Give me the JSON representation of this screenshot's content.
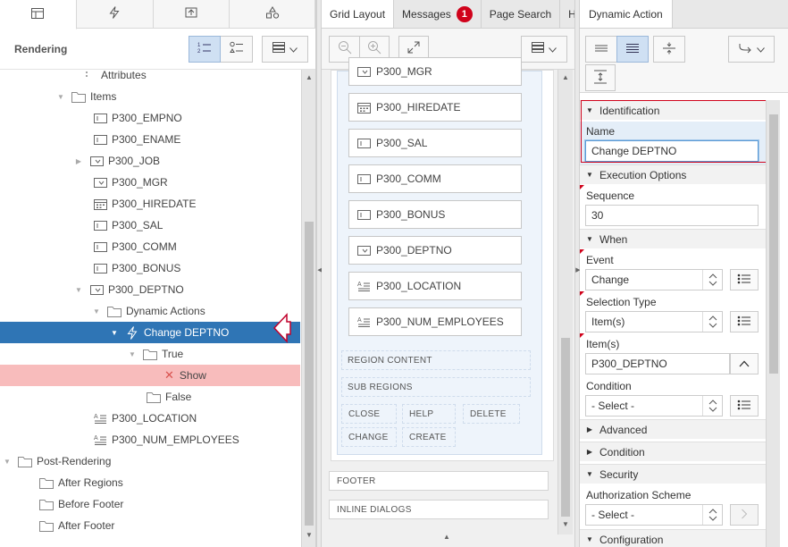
{
  "left": {
    "header_title": "Rendering",
    "tabs": [
      "rendering-tab-icon",
      "dynamic-actions-tab-icon",
      "processing-tab-icon",
      "shared-components-tab-icon"
    ],
    "tree": [
      {
        "label": "Attributes",
        "indent": 92,
        "icon": "attributes-icon",
        "toggle": ""
      },
      {
        "label": "Items",
        "indent": 80,
        "icon": "folder-icon",
        "toggle": "▼"
      },
      {
        "label": "P300_EMPNO",
        "indent": 104,
        "icon": "text-field-icon",
        "toggle": ""
      },
      {
        "label": "P300_ENAME",
        "indent": 104,
        "icon": "text-field-icon",
        "toggle": ""
      },
      {
        "label": "P300_JOB",
        "indent": 100,
        "icon": "select-list-icon",
        "toggle": "▶"
      },
      {
        "label": "P300_MGR",
        "indent": 104,
        "icon": "select-list-icon",
        "toggle": ""
      },
      {
        "label": "P300_HIREDATE",
        "indent": 104,
        "icon": "date-picker-icon",
        "toggle": ""
      },
      {
        "label": "P300_SAL",
        "indent": 104,
        "icon": "text-field-icon",
        "toggle": ""
      },
      {
        "label": "P300_COMM",
        "indent": 104,
        "icon": "text-field-icon",
        "toggle": ""
      },
      {
        "label": "P300_BONUS",
        "indent": 104,
        "icon": "text-field-icon",
        "toggle": ""
      },
      {
        "label": "P300_DEPTNO",
        "indent": 100,
        "icon": "select-list-icon",
        "toggle": "▼"
      },
      {
        "label": "Dynamic Actions",
        "indent": 120,
        "icon": "folder-icon",
        "toggle": "▼"
      },
      {
        "label": "Change DEPTNO",
        "indent": 140,
        "icon": "lightning-icon",
        "toggle": "▼",
        "selected": true
      },
      {
        "label": "True",
        "indent": 160,
        "icon": "folder-icon",
        "toggle": "▼"
      },
      {
        "label": "Show",
        "indent": 184,
        "icon": "error-icon",
        "toggle": "",
        "error": true
      },
      {
        "label": "False",
        "indent": 164,
        "icon": "folder-icon",
        "toggle": ""
      },
      {
        "label": "P300_LOCATION",
        "indent": 104,
        "icon": "textarea-icon",
        "toggle": ""
      },
      {
        "label": "P300_NUM_EMPLOYEES",
        "indent": 104,
        "icon": "textarea-icon",
        "toggle": ""
      },
      {
        "label": "Post-Rendering",
        "indent": 20,
        "icon": "folder-icon",
        "toggle": "▼"
      },
      {
        "label": "After Regions",
        "indent": 44,
        "icon": "folder-icon",
        "toggle": ""
      },
      {
        "label": "Before Footer",
        "indent": 44,
        "icon": "folder-icon",
        "toggle": ""
      },
      {
        "label": "After Footer",
        "indent": 44,
        "icon": "folder-icon",
        "toggle": ""
      }
    ]
  },
  "middle": {
    "tabs": [
      {
        "label": "Grid Layout",
        "active": true
      },
      {
        "label": "Messages",
        "badge": "1"
      },
      {
        "label": "Page Search"
      },
      {
        "label": "H"
      }
    ],
    "items": [
      {
        "label": "P300_MGR",
        "icon": "select-list-icon"
      },
      {
        "label": "P300_HIREDATE",
        "icon": "date-picker-icon"
      },
      {
        "label": "P300_SAL",
        "icon": "text-field-icon"
      },
      {
        "label": "P300_COMM",
        "icon": "text-field-icon"
      },
      {
        "label": "P300_BONUS",
        "icon": "text-field-icon"
      },
      {
        "label": "P300_DEPTNO",
        "icon": "select-list-icon"
      },
      {
        "label": "P300_LOCATION",
        "icon": "textarea-icon"
      },
      {
        "label": "P300_NUM_EMPLOYEES",
        "icon": "textarea-icon"
      }
    ],
    "region_content": "REGION CONTENT",
    "sub_regions": "SUB REGIONS",
    "buttons": [
      "CLOSE",
      "HELP",
      "DELETE",
      "CHANGE",
      "CREATE"
    ],
    "footer": "FOOTER",
    "inline_dialogs": "INLINE DIALOGS"
  },
  "right": {
    "tab": "Dynamic Action",
    "sections": {
      "identification": "Identification",
      "execution_options": "Execution Options",
      "when": "When",
      "advanced": "Advanced",
      "condition": "Condition",
      "security": "Security",
      "configuration": "Configuration"
    },
    "fields": {
      "name_label": "Name",
      "name_value": "Change DEPTNO",
      "sequence_label": "Sequence",
      "sequence_value": "30",
      "event_label": "Event",
      "event_value": "Change",
      "selection_type_label": "Selection Type",
      "selection_type_value": "Item(s)",
      "items_label": "Item(s)",
      "items_value": "P300_DEPTNO",
      "condition_label": "Condition",
      "condition_value": "- Select -",
      "auth_label": "Authorization Scheme",
      "auth_value": "- Select -"
    }
  },
  "colors": {
    "selected_row": "#2f75b5",
    "error_row": "#f8bcbc",
    "badge": "#d0021b",
    "highlight_box": "#d0021b"
  }
}
